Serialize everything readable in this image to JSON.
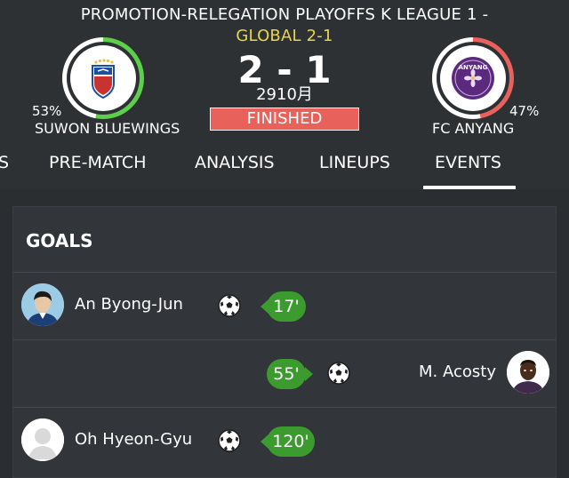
{
  "match": {
    "league_line1": "PROMOTION-RELEGATION PLAYOFFS K LEAGUE 1 -",
    "league_line2": "GLOBAL 2-1",
    "score": "2 - 1",
    "date": "2910月",
    "status": "FINISHED"
  },
  "home": {
    "name": "SUWON BLUEWINGS",
    "possession": "53%",
    "possession_value": 0.53,
    "ring_color": "#5dd04a",
    "crest_icon": "suwon-bluewings-crest-icon"
  },
  "away": {
    "name": "FC ANYANG",
    "possession": "47%",
    "possession_value": 0.47,
    "ring_color": "#e8615a",
    "crest_icon": "fc-anyang-crest-icon"
  },
  "tabs": [
    {
      "label": "S"
    },
    {
      "label": "PRE-MATCH"
    },
    {
      "label": "ANALYSIS"
    },
    {
      "label": "LINEUPS"
    },
    {
      "label": "EVENTS",
      "active": true
    }
  ],
  "events": {
    "section_title": "GOALS",
    "goals": [
      {
        "player": "An Byong-Jun",
        "minute": "17'",
        "side": "home",
        "icon": "soccer-ball-icon"
      },
      {
        "player": "M. Acosty",
        "minute": "55'",
        "side": "away",
        "icon": "soccer-ball-icon"
      },
      {
        "player": "Oh Hyeon-Gyu",
        "minute": "120'",
        "side": "home",
        "icon": "soccer-ball-icon"
      }
    ]
  },
  "colors": {
    "background": "#2b2e31",
    "card": "#323539",
    "minute_pill": "#3c9b2f",
    "status_pill": "#e8615a",
    "league_accent": "#e8d44a"
  }
}
